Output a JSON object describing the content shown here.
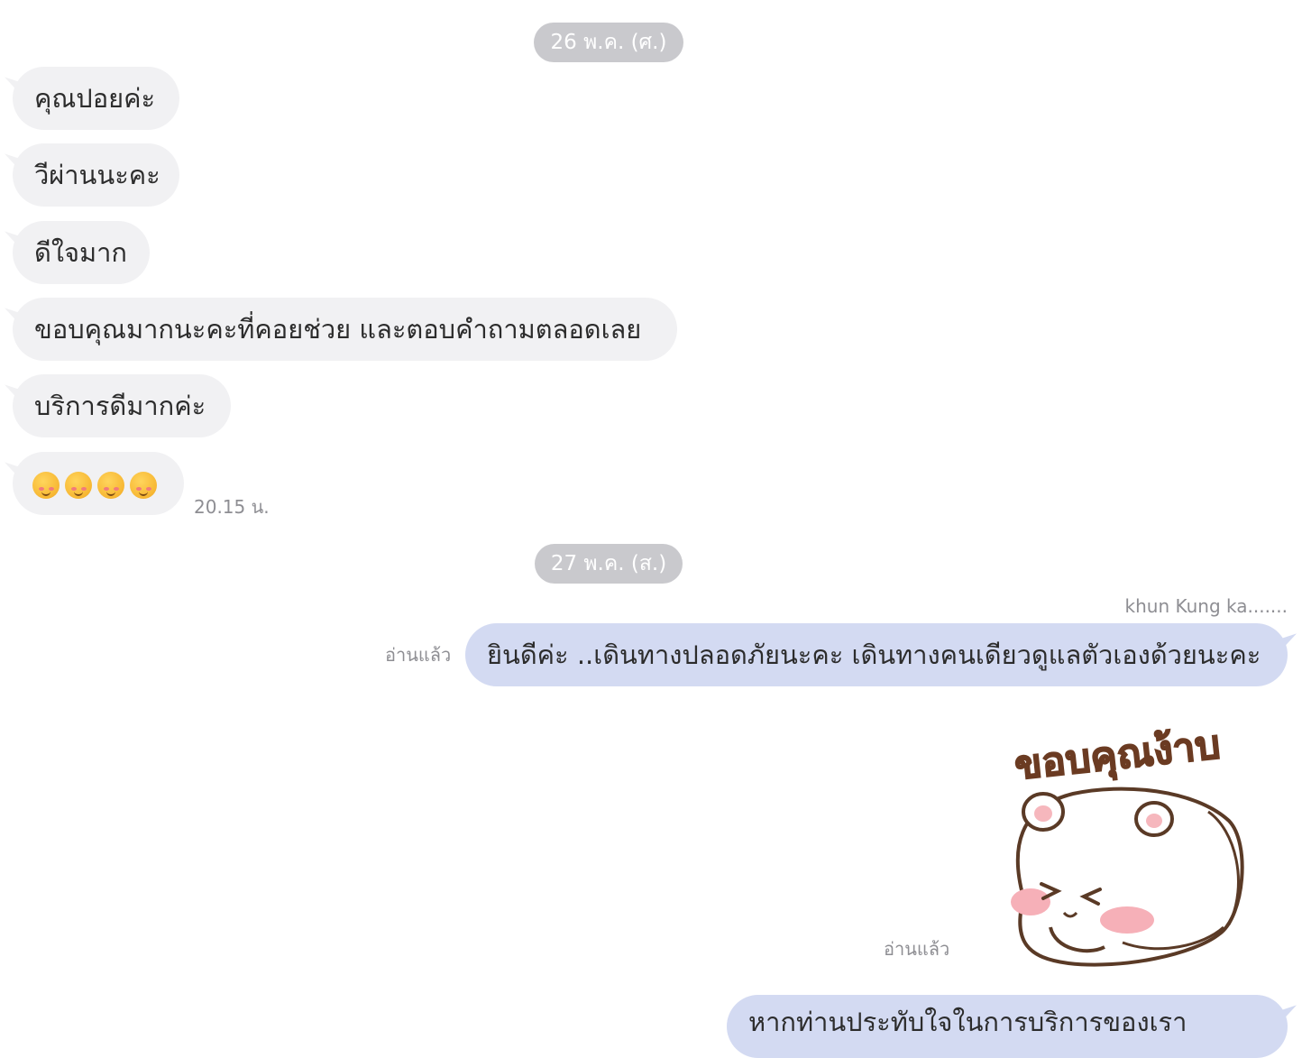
{
  "dates": [
    "26 พ.ค. (ศ.)",
    "27 พ.ค. (ส.)"
  ],
  "incoming": [
    "คุณปอยค่ะ",
    "วีผ่านนะคะ",
    "ดีใจมาก",
    "ขอบคุณมากนะคะที่คอยช่วย และตอบคำถามตลอดเลย",
    "บริการดีมากค่ะ"
  ],
  "emoji_message": {
    "emojis": [
      "smiling-face-with-hearts",
      "smiling-face-with-hearts",
      "smiling-face-with-hearts",
      "smiling-face-with-hearts"
    ],
    "time": "20.15 น."
  },
  "outgoing": {
    "sender": "khun Kung  ka.......",
    "message": "ยินดีค่ะ ..เดินทางปลอดภัยนะคะ เดินทางคนเดียวดูแลตัวเองด้วยนะคะ",
    "read": "อ่านแล้ว"
  },
  "sticker": {
    "text": "ขอบคุณง้าบ",
    "read": "อ่านแล้ว"
  },
  "partial_message": "หากท่านประทับใจในการบริการของเรา"
}
